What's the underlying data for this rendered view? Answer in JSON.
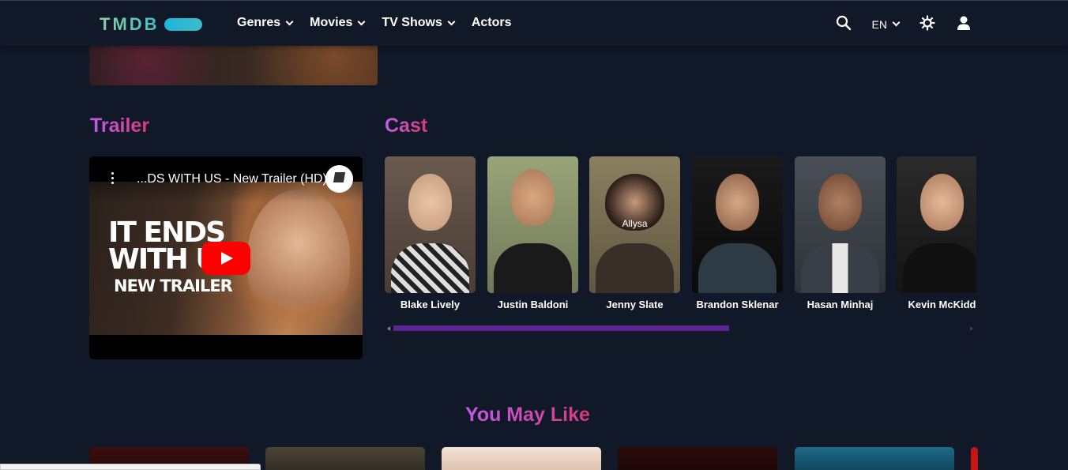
{
  "header": {
    "logo": "TMDB",
    "nav": [
      {
        "label": "Genres",
        "dropdown": true
      },
      {
        "label": "Movies",
        "dropdown": true
      },
      {
        "label": "TV Shows",
        "dropdown": true
      },
      {
        "label": "Actors",
        "dropdown": false
      }
    ],
    "language": "EN",
    "icons": [
      "search-icon",
      "theme-toggle-icon",
      "user-icon"
    ]
  },
  "trailer": {
    "heading": "Trailer",
    "video_title": "...DS WITH US - New Trailer (HD)",
    "thumbnail_title_big": "IT ENDS\nWITH US",
    "thumbnail_title_small": "NEW TRAILER"
  },
  "cast": {
    "heading": "Cast",
    "members": [
      {
        "name": "Blake Lively",
        "alt": ""
      },
      {
        "name": "Justin Baldoni",
        "alt": ""
      },
      {
        "name": "Jenny Slate",
        "alt": "Allysa"
      },
      {
        "name": "Brandon Sklenar",
        "alt": ""
      },
      {
        "name": "Hasan Minhaj",
        "alt": ""
      },
      {
        "name": "Kevin McKidd",
        "alt": ""
      }
    ]
  },
  "you_may_like": {
    "heading": "You May Like"
  },
  "colors": {
    "background": "#111827",
    "accent_gradient_start": "#c05ce8",
    "accent_gradient_end": "#d83a7c",
    "scrollbar": "#5b2490",
    "play_button": "#ff0000"
  }
}
